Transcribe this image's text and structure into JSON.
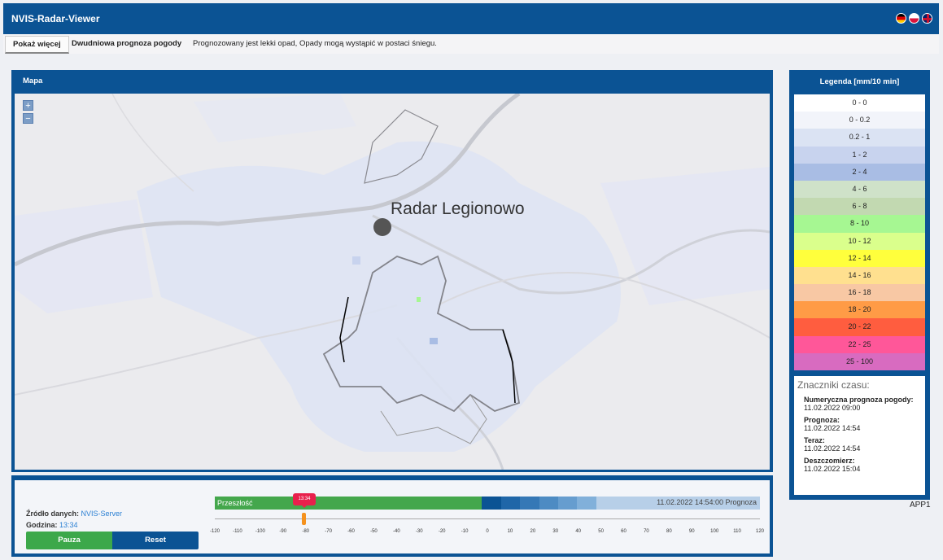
{
  "header": {
    "title": "NVIS-Radar-Viewer",
    "languages": [
      "de-flag-icon",
      "pl-flag-icon",
      "uk-flag-icon"
    ]
  },
  "info": {
    "show_more": "Pokaż więcej",
    "forecast_title": "Dwudniowa prognoza pogody",
    "forecast_text": "Prognozowany jest lekki opad, Opady mogą wystąpić w postaci śniegu."
  },
  "map": {
    "title": "Mapa",
    "zoom_in": "+",
    "zoom_out": "−",
    "radar_label": "Radar Legionowo"
  },
  "controls": {
    "source_label": "Źródło danych:",
    "source_value": "NVIS-Server",
    "hour_label": "Godzina:",
    "hour_value": "13:34",
    "pause": "Pauza",
    "reset": "Reset",
    "past_label": "Przeszłość",
    "forecast_label": "11.02.2022 14:54:00 Prognoza",
    "marker_label": "13:34",
    "slider_value_minutes": -80,
    "ticks": [
      "-120",
      "-110",
      "-100",
      "-90",
      "-80",
      "-70",
      "-60",
      "-50",
      "-40",
      "-30",
      "-20",
      "-10",
      "0",
      "10",
      "20",
      "30",
      "40",
      "50",
      "60",
      "70",
      "80",
      "90",
      "100",
      "110",
      "120"
    ]
  },
  "legend": {
    "title": "Legenda [mm/10 min]",
    "items": [
      {
        "label": "0 - 0",
        "color": "#ffffff"
      },
      {
        "label": "0 - 0.2",
        "color": "#f2f4fa"
      },
      {
        "label": "0.2 - 1",
        "color": "#dbe3f3"
      },
      {
        "label": "1 - 2",
        "color": "#c8d3ee"
      },
      {
        "label": "2 - 4",
        "color": "#a9bde4"
      },
      {
        "label": "4 - 6",
        "color": "#cfe2c9"
      },
      {
        "label": "6 - 8",
        "color": "#c2d9b1"
      },
      {
        "label": "8 - 10",
        "color": "#a6f792"
      },
      {
        "label": "10 - 12",
        "color": "#daff8c"
      },
      {
        "label": "12 - 14",
        "color": "#ffff3c"
      },
      {
        "label": "14 - 16",
        "color": "#ffe08f"
      },
      {
        "label": "16 - 18",
        "color": "#f8c8a4"
      },
      {
        "label": "18 - 20",
        "color": "#ff9b46"
      },
      {
        "label": "20 - 22",
        "color": "#ff5d3f"
      },
      {
        "label": "22 - 25",
        "color": "#ff5799"
      },
      {
        "label": "25 - 100",
        "color": "#d86bc0"
      }
    ]
  },
  "timestamps": {
    "heading": "Znaczniki czasu:",
    "items": [
      {
        "label": "Numeryczna prognoza pogody:",
        "value": "11.02.2022 09:00"
      },
      {
        "label": "Prognoza:",
        "value": "11.02.2022 14:54"
      },
      {
        "label": "Teraz:",
        "value": "11.02.2022 14:54"
      },
      {
        "label": "Deszczomierz:",
        "value": "11.02.2022 15:04"
      }
    ]
  },
  "footer": {
    "app_id": "APP1"
  }
}
